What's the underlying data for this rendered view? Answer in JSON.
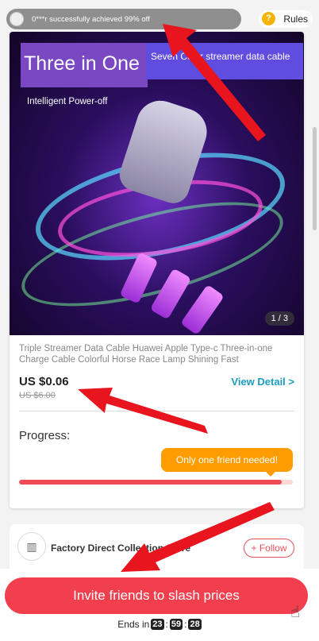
{
  "notice": {
    "text": "0***r successfully achieved 99% off"
  },
  "rules": {
    "label": "Rules",
    "icon": "?"
  },
  "product": {
    "image_title": "Three in One",
    "image_subtitle": "Seven Color streamer data cable",
    "image_caption": "Intelligent Power-off",
    "image_counter": "1 / 3",
    "title": "Triple Streamer Data Cable Huawei Apple Type-c Three-in-one Charge Cable Colorful Horse Race Lamp Shining Fast",
    "price": "US $0.06",
    "old_price": "US $6.00",
    "view_detail": "View Detail >"
  },
  "progress": {
    "label": "Progress:",
    "tooltip": "Only one friend needed!",
    "value": 0.96,
    "fill_color": "#ef4a55"
  },
  "store": {
    "name": "Factory Direct Collection Store",
    "follow": "+ Follow"
  },
  "cta": {
    "label": "Invite friends to slash prices"
  },
  "countdown": {
    "prefix": "Ends in",
    "hours": "23",
    "minutes": "59",
    "seconds": "28"
  }
}
